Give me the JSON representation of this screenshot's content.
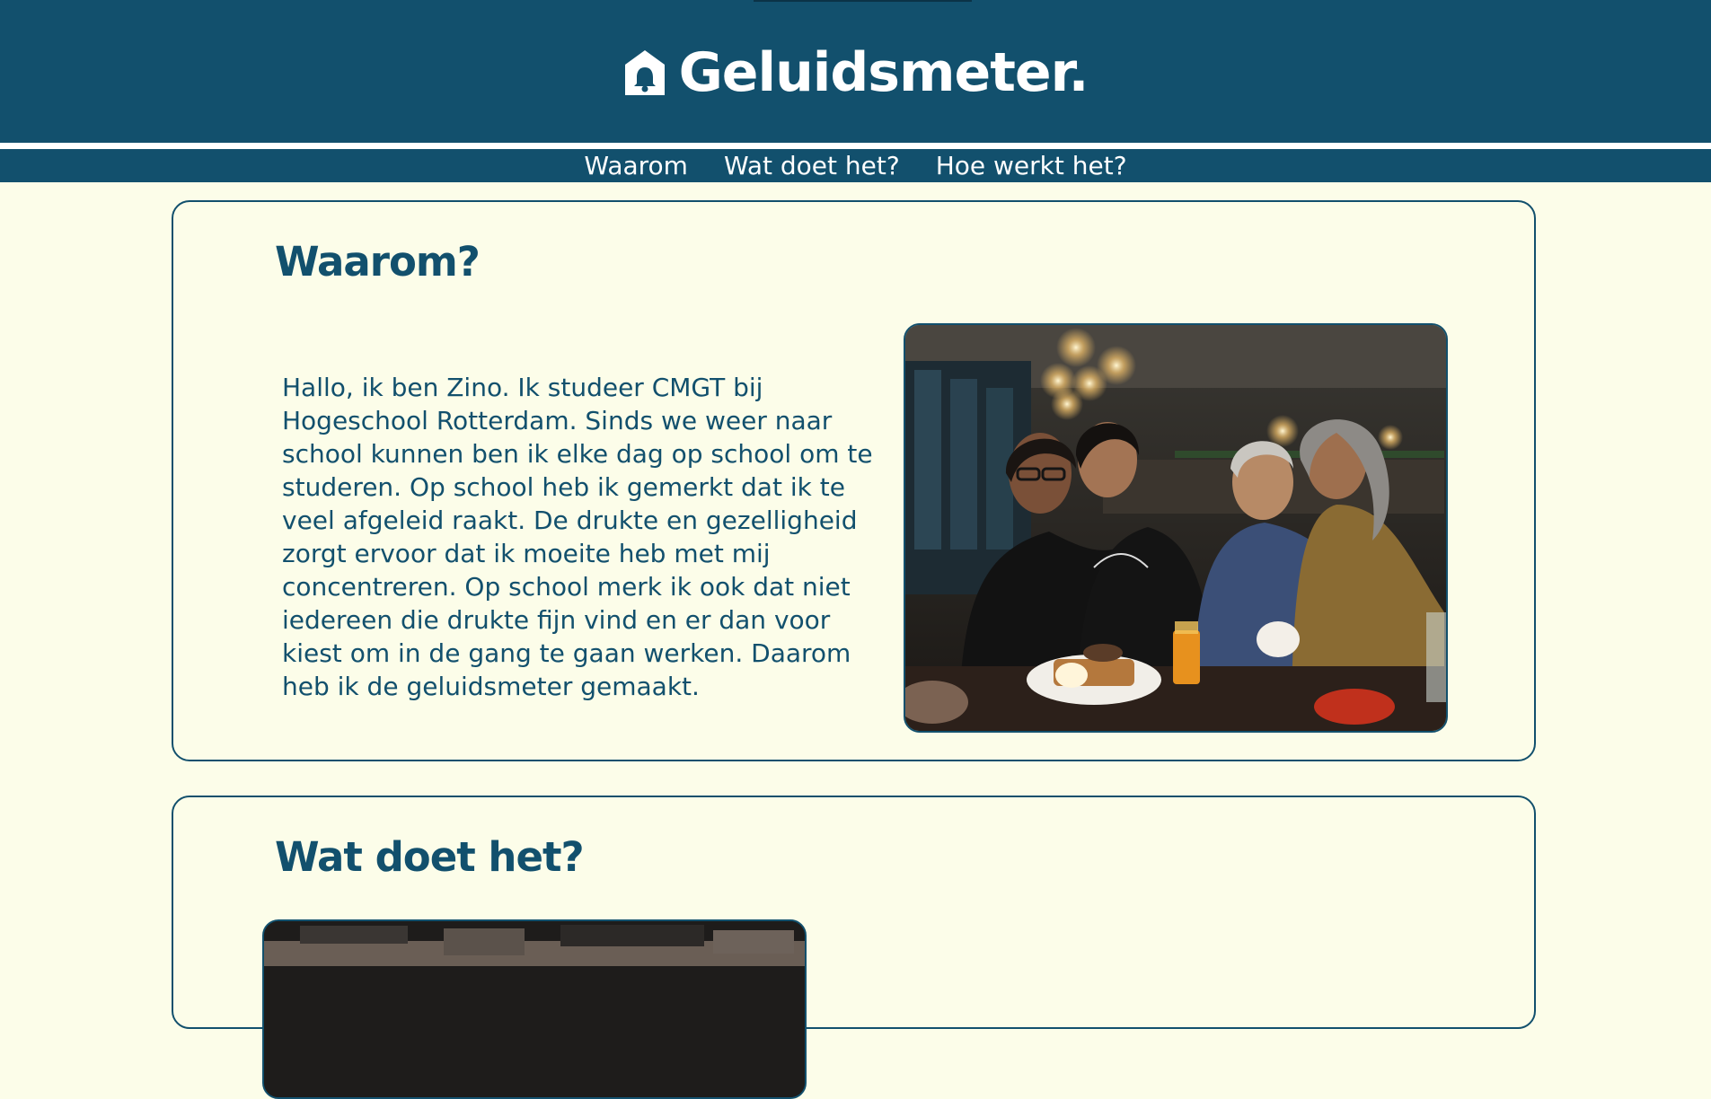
{
  "header": {
    "title": "Geluidsmeter.",
    "logo_icon": "house-bell-icon"
  },
  "nav": {
    "items": [
      {
        "label": "Waarom"
      },
      {
        "label": "Wat doet het?"
      },
      {
        "label": "Hoe werkt het?"
      }
    ]
  },
  "sections": [
    {
      "title": "Waarom?",
      "text": "Hallo, ik ben Zino. Ik studeer CMGT bij Hogeschool Rotterdam. Sinds we weer naar school kunnen ben ik elke dag op school om te studeren. Op school heb ik gemerkt dat ik te veel afgeleid raakt. De drukte en gezelligheid zorgt ervoor dat ik moeite heb met mij concentreren. Op school merk ik ook dat niet iedereen die drukte fijn vind en er dan voor kiest om in de gang te gaan werken. Daarom heb ik de geluidsmeter gemaakt."
    },
    {
      "title": "Wat doet het?"
    }
  ],
  "colors": {
    "primary": "#12506d",
    "background": "#fcfde9",
    "white": "#ffffff"
  }
}
